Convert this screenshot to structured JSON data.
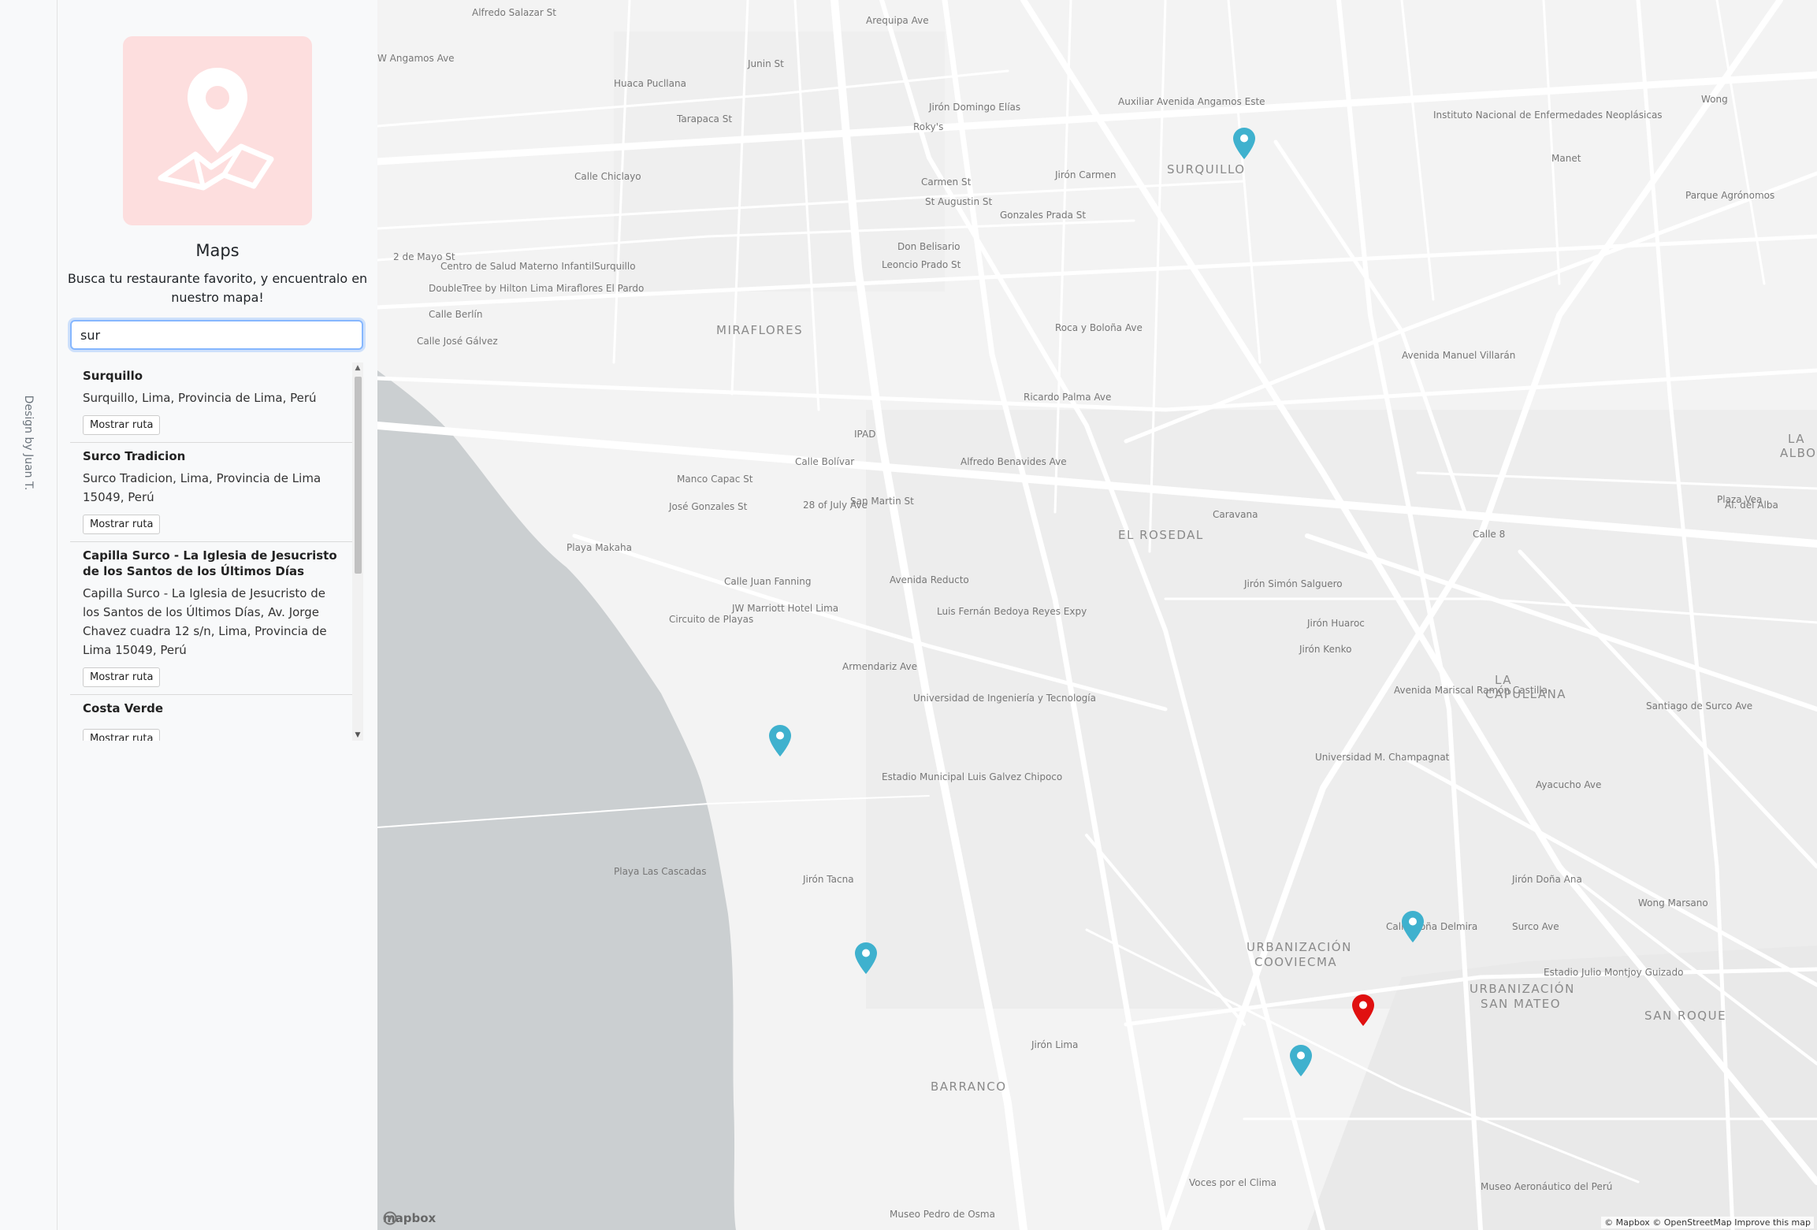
{
  "sidebar": {
    "credit": "Design by Juan T."
  },
  "panel": {
    "title": "Maps",
    "subtitle": "Busca tu restaurante favorito, y encuentralo en nuestro mapa!",
    "search_value": "sur",
    "results": [
      {
        "name": "Surquillo",
        "address": "Surquillo, Lima, Provincia de Lima, Perú",
        "button": "Mostrar ruta"
      },
      {
        "name": "Surco Tradicion",
        "address": "Surco Tradicion, Lima, Provincia de Lima 15049, Perú",
        "button": "Mostrar ruta"
      },
      {
        "name": "Capilla Surco - La Iglesia de Jesucristo de los Santos de los Últimos Días",
        "address": "Capilla Surco - La Iglesia de Jesucristo de los Santos de los Últimos Días, Av. Jorge Chavez cuadra 12 s/n, Lima, Provincia de Lima 15049, Perú",
        "button": "Mostrar ruta"
      },
      {
        "name": "Costa Verde",
        "address": "",
        "button": "Mostrar ruta"
      }
    ]
  },
  "map": {
    "brand": "mapbox",
    "attribution": "© Mapbox © OpenStreetMap  Improve this map",
    "colors": {
      "marker": "#3fb1ce",
      "selected_marker": "#e01010",
      "water": "#cbcfd1",
      "land": "#f3f3f3",
      "road": "#ffffff"
    },
    "district_labels": [
      "SURQUILLO",
      "MIRAFLORES",
      "EL ROSEDAL",
      "BARRANCO",
      "URBANIZACIÓN",
      "COOVIECMA",
      "URBANIZACIÓN",
      "SAN MATEO",
      "SAN ROQUE",
      "LA",
      "CAPULLANA",
      "LA",
      "ALBORA"
    ],
    "street_labels": [
      "Alfredo Salazar St",
      "W Angamos Ave",
      "Huaca Pucllana",
      "Tarapaca St",
      "Junin St",
      "Arequipa Ave",
      "Jirón Domingo Elías",
      "Roky's",
      "Auxiliar Avenida Angamos Este",
      "Instituto Nacional de Enfermedades Neoplásicas",
      "Wong",
      "Manet",
      "Calle Chiclayo",
      "Carmen St",
      "St Augustin St",
      "Gonzales Prada St",
      "Jirón Carmen",
      "Parque Agrónomos",
      "Don Belisario",
      "Leoncio Prado St",
      "Centro de Salud Materno InfantilSurquillo",
      "DoubleTree by Hilton Lima Miraflores El Pardo",
      "2 de Mayo St",
      "Calle Berlín",
      "Calle José Gálvez",
      "Roca y Boloña Ave",
      "Avenida Manuel Villarán",
      "Ricardo Palma Ave",
      "Alfredo Benavides Ave",
      "IPAD",
      "Calle Bolívar",
      "Manco Capac St",
      "José Gonzales St",
      "28 of July Ave",
      "San Martin St",
      "Plaza Vea",
      "Caravana",
      "Calle 8",
      "Al. del Alba",
      "Playa Makaha",
      "Calle Juan Fanning",
      "JW Marriott Hotel Lima",
      "Circuito de Playas",
      "Armendariz Ave",
      "Universidad de Ingeniería y Tecnología",
      "Jirón Simón Salguero",
      "Jirón Huaroc",
      "Jirón Kenko",
      "Avenida Mariscal Ramón Castilla",
      "Universidad M. Champagnat",
      "Estadio Municipal Luis Galvez Chipoco",
      "Playa Las Cascadas",
      "Calle Doña Delmira",
      "Jirón Doña Ana",
      "Wong Marsano",
      "Estadio Julio Montjoy Guizado",
      "Voces por el Clima",
      "Museo Aeronáutico del Perú",
      "Museo Pedro de Osma",
      "Surco Ave",
      "Ayacucho Ave",
      "Santiago de Surco Ave",
      "Jirón Lima",
      "Luis Fernán Bedoya Reyes Expy",
      "Avenida Reducto",
      "Jirón Tacna"
    ]
  }
}
